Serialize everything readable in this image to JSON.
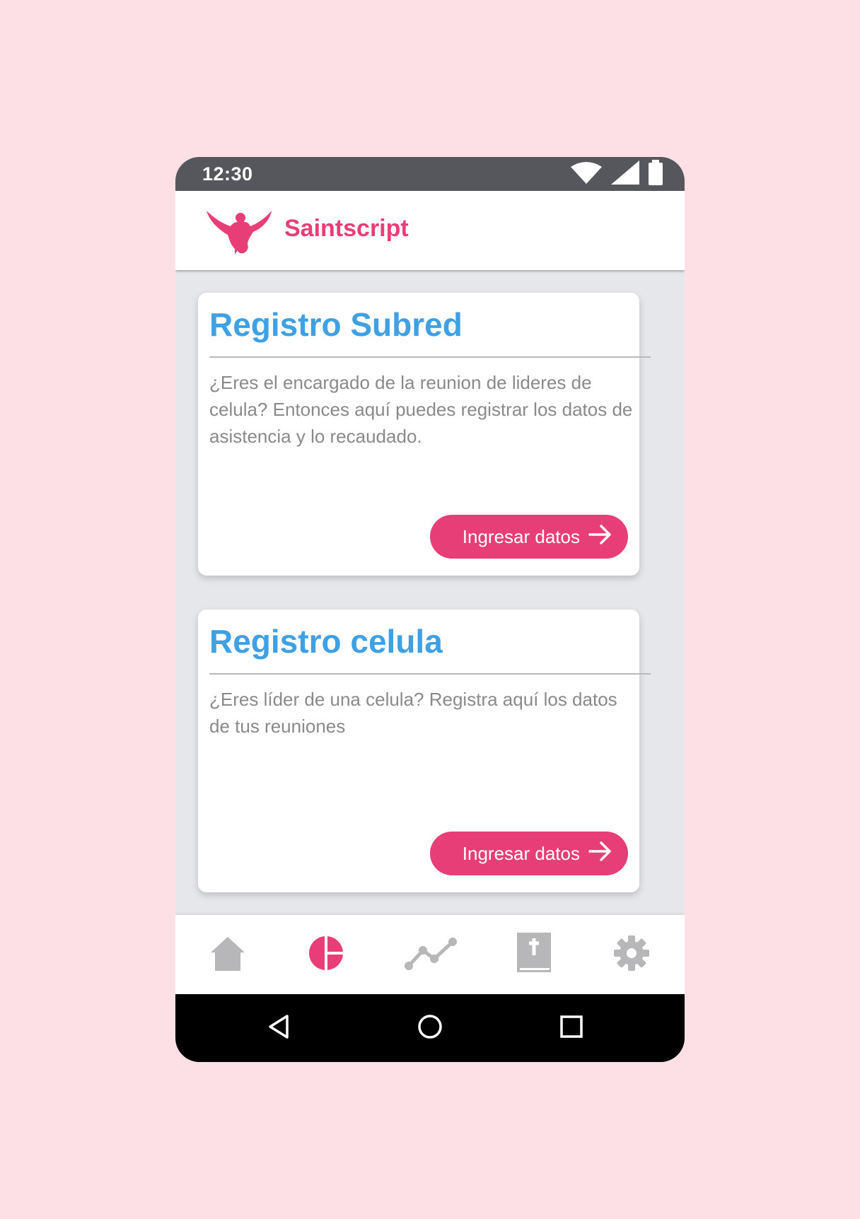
{
  "status_bar": {
    "time": "12:30",
    "icons": [
      "wifi-icon",
      "signal-icon",
      "battery-icon"
    ]
  },
  "app_bar": {
    "title": "Saintscript",
    "logo_icon": "dove-logo-icon"
  },
  "cards": [
    {
      "title": "Registro Subred",
      "description": "¿Eres el encargado de la reunion de lideres de celula? Entonces aquí puedes registrar los datos de asistencia y lo recaudado.",
      "button_label": "Ingresar datos",
      "button_icon": "arrow-right-icon"
    },
    {
      "title": "Registro celula",
      "description": "¿Eres líder de una celula? Registra aquí los datos de tus reuniones",
      "button_label": "Ingresar datos",
      "button_icon": "arrow-right-icon"
    }
  ],
  "bottom_nav": {
    "items": [
      {
        "icon": "home-icon",
        "active": false
      },
      {
        "icon": "pie-chart-icon",
        "active": true
      },
      {
        "icon": "line-chart-icon",
        "active": false
      },
      {
        "icon": "bible-icon",
        "active": false
      },
      {
        "icon": "gear-icon",
        "active": false
      }
    ]
  },
  "system_nav": {
    "buttons": [
      "back-icon",
      "home-circle-icon",
      "recents-icon"
    ]
  },
  "colors": {
    "background": "#fde0e5",
    "accent": "#e83e78",
    "title_blue": "#3fa1e3",
    "status_bar": "#55575c",
    "nav_inactive": "#b7b7b9"
  }
}
